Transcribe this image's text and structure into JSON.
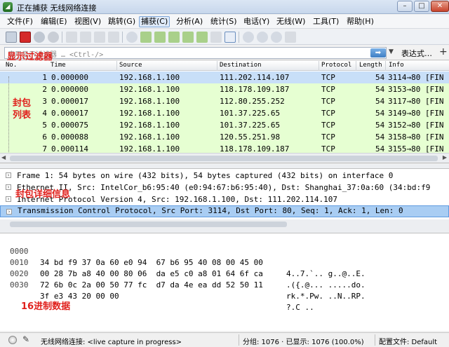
{
  "window": {
    "title": "正在捕获 无线网络连接"
  },
  "menu": [
    "文件(F)",
    "编辑(E)",
    "视图(V)",
    "跳转(G)",
    "捕获(C)",
    "分析(A)",
    "统计(S)",
    "电话(Y)",
    "无线(W)",
    "工具(T)",
    "帮助(H)"
  ],
  "filter": {
    "placeholder": "应用显示过滤器 … <Ctrl-/>",
    "expression_label": "表达式…",
    "plus_label": "+"
  },
  "packet_list": {
    "columns": [
      "No.",
      "Time",
      "Source",
      "Destination",
      "Protocol",
      "Length",
      "Info"
    ],
    "rows": [
      {
        "no": "1",
        "time": "0.000000",
        "src": "192.168.1.100",
        "dst": "111.202.114.107",
        "proto": "TCP",
        "len": "54",
        "info": "3114→80 [FIN"
      },
      {
        "no": "2",
        "time": "0.000000",
        "src": "192.168.1.100",
        "dst": "118.178.109.187",
        "proto": "TCP",
        "len": "54",
        "info": "3153→80 [FIN"
      },
      {
        "no": "3",
        "time": "0.000017",
        "src": "192.168.1.100",
        "dst": "112.80.255.252",
        "proto": "TCP",
        "len": "54",
        "info": "3117→80 [FIN"
      },
      {
        "no": "4",
        "time": "0.000017",
        "src": "192.168.1.100",
        "dst": "101.37.225.65",
        "proto": "TCP",
        "len": "54",
        "info": "3149→80 [FIN"
      },
      {
        "no": "5",
        "time": "0.000075",
        "src": "192.168.1.100",
        "dst": "101.37.225.65",
        "proto": "TCP",
        "len": "54",
        "info": "3152→80 [FIN"
      },
      {
        "no": "6",
        "time": "0.000088",
        "src": "192.168.1.100",
        "dst": "120.55.251.98",
        "proto": "TCP",
        "len": "54",
        "info": "3158→80 [FIN"
      },
      {
        "no": "7",
        "time": "0.000114",
        "src": "192.168.1.100",
        "dst": "118.178.109.187",
        "proto": "TCP",
        "len": "54",
        "info": "3155→80 [FIN"
      }
    ]
  },
  "details": [
    "Frame 1: 54 bytes on wire (432 bits), 54 bytes captured (432 bits) on interface 0",
    "Ethernet II, Src: IntelCor_b6:95:40 (e0:94:67:b6:95:40), Dst: Shanghai_37:0a:60 (34:bd:f9",
    "Internet Protocol Version 4, Src: 192.168.1.100, Dst: 111.202.114.107",
    "Transmission Control Protocol, Src Port: 3114, Dst Port: 80, Seq: 1, Ack: 1, Len: 0"
  ],
  "hex": [
    {
      "offset": "0000",
      "bytes": "34 bd f9 37 0a 60 e0 94  67 b6 95 40 08 00 45 00",
      "ascii": "4..7.`.. g..@..E."
    },
    {
      "offset": "0010",
      "bytes": "00 28 7b a8 40 00 80 06  da e5 c0 a8 01 64 6f ca",
      "ascii": ".({.@... .....do."
    },
    {
      "offset": "0020",
      "bytes": "72 6b 0c 2a 00 50 77 fc  d7 da 4e ea dd 52 50 11",
      "ascii": "rk.*.Pw. ..N..RP."
    },
    {
      "offset": "0030",
      "bytes": "3f e3 43 20 00 00",
      "ascii": "?.C .."
    }
  ],
  "annotations": {
    "filter": "显示过滤器",
    "packet_list_line1": "封包",
    "packet_list_line2": "列表",
    "details": "封包详细信息",
    "hex": "16进制数据"
  },
  "status": {
    "interface": "无线网络连接: <live capture in progress>",
    "packets": "分组: 1076 · 已显示: 1076 (100.0%)",
    "profile": "配置文件: Default"
  },
  "colors": {
    "tcp_row": "#e6ffd2",
    "selected_row": "#c8dff8",
    "selected_detail": "#a9cdf3",
    "annotation": "#e0201c"
  }
}
